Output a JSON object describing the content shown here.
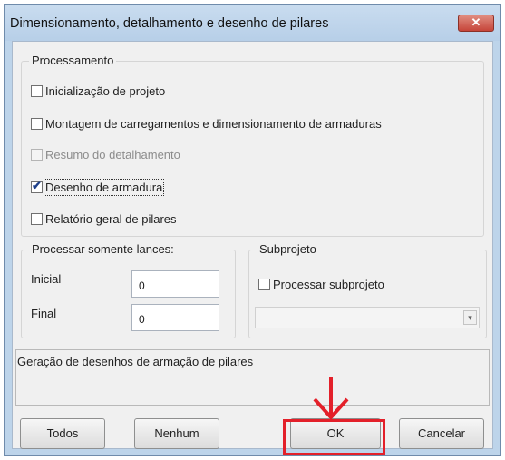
{
  "window": {
    "title": "Dimensionamento, detalhamento e desenho de pilares",
    "close_label": "✕"
  },
  "processamento": {
    "legend": "Processamento",
    "items": [
      {
        "label": "Inicialização de projeto",
        "checked": false,
        "enabled": true
      },
      {
        "label": "Montagem de carregamentos e dimensionamento de armaduras",
        "checked": false,
        "enabled": true
      },
      {
        "label": "Resumo do detalhamento",
        "checked": false,
        "enabled": false
      },
      {
        "label": "Desenho de armadura",
        "checked": true,
        "enabled": true
      },
      {
        "label": "Relatório geral de pilares",
        "checked": false,
        "enabled": true
      }
    ]
  },
  "lances": {
    "legend": "Processar somente lances:",
    "inicial_label": "Inicial",
    "inicial_value": "0",
    "final_label": "Final",
    "final_value": "0"
  },
  "subprojeto": {
    "legend": "Subprojeto",
    "checkbox_label": "Processar subprojeto",
    "checked": false,
    "combo_value": ""
  },
  "status_text": "Geração de desenhos de armação de pilares",
  "buttons": {
    "todos": "Todos",
    "nenhum": "Nenhum",
    "ok": "OK",
    "cancelar": "Cancelar"
  },
  "annotation_color": "#e3202a"
}
